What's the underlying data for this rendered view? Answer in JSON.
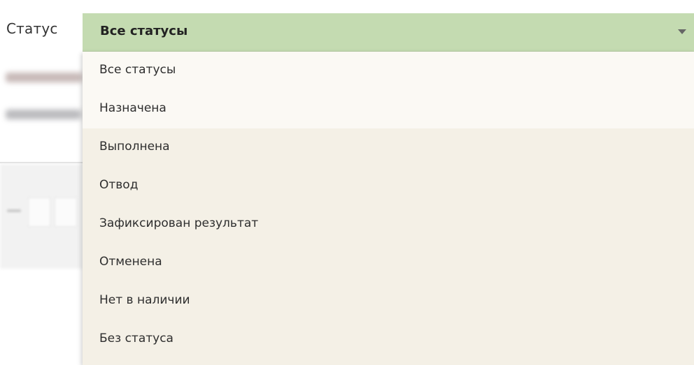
{
  "filter": {
    "label": "Статус",
    "selected": "Все статусы"
  },
  "dropdown": {
    "options": [
      "Все статусы",
      "Назначена",
      "Выполнена",
      "Отвод",
      "Зафиксирован результат",
      "Отменена",
      "Нет в наличии",
      "Без статуса"
    ]
  },
  "colors": {
    "select_bg": "#c4dbb1",
    "dropdown_bg": "#f4f0e6",
    "highlight_bg": "#fbf9f4",
    "text": "#2e2e2e"
  },
  "icons": {
    "select_arrow": "caret-down-icon"
  }
}
